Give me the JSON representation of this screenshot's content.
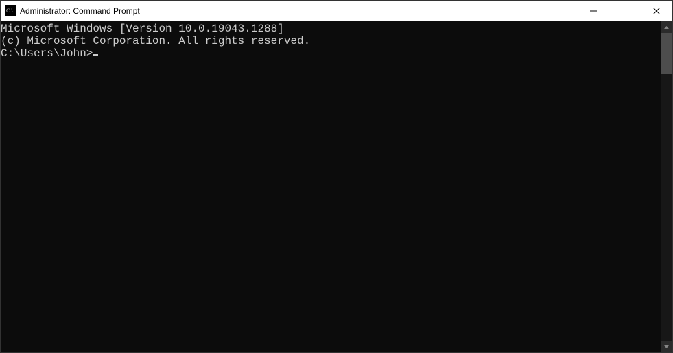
{
  "window": {
    "title": "Administrator: Command Prompt"
  },
  "terminal": {
    "line1": "Microsoft Windows [Version 10.0.19043.1288]",
    "line2": "(c) Microsoft Corporation. All rights reserved.",
    "blank": "",
    "prompt": "C:\\Users\\John>"
  }
}
